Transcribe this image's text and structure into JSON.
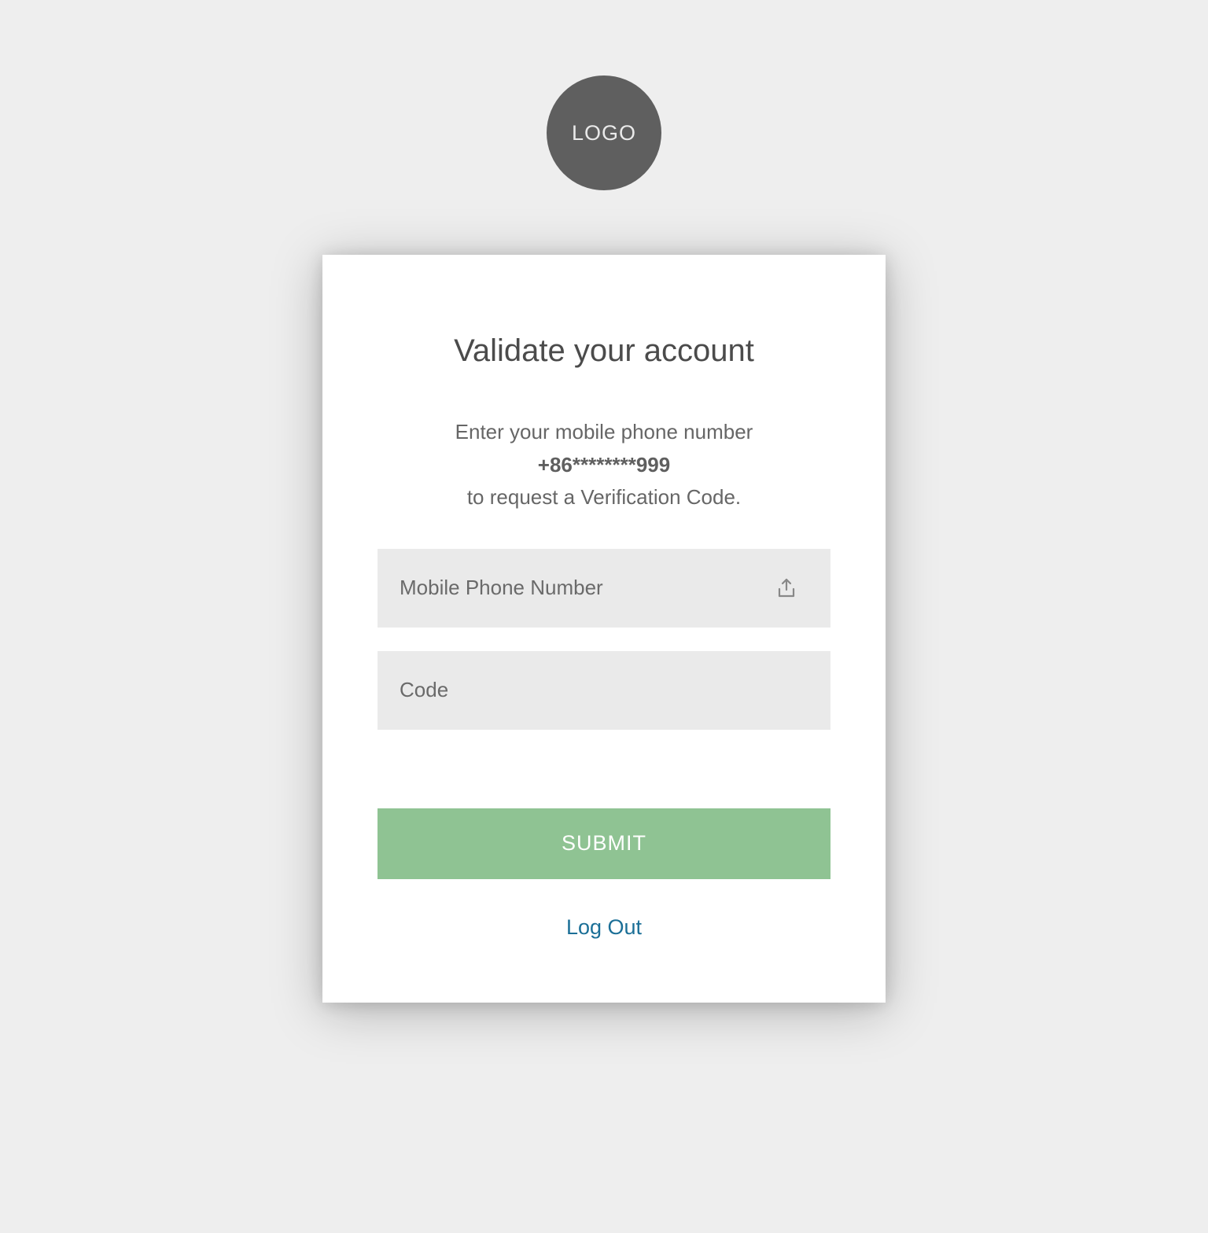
{
  "logo": {
    "text": "LOGO"
  },
  "card": {
    "title": "Validate your account",
    "instruction_line1": "Enter your mobile phone number",
    "masked_number": "+86********999",
    "instruction_line2": "to request a Verification Code.",
    "phone_input": {
      "placeholder": "Mobile Phone Number"
    },
    "code_input": {
      "placeholder": "Code"
    },
    "submit_label": "SUBMIT",
    "logout_label": "Log Out"
  }
}
